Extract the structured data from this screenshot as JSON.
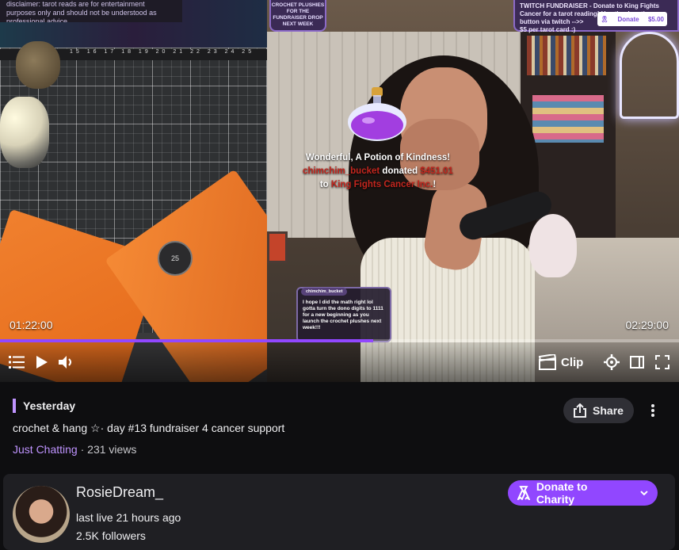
{
  "video": {
    "disclaimer": "disclaimer: tarot reads are for entertainment purposes only and should not be understood as professional advice.",
    "ruler_ticks": "15 16 17 18 19 20 21 22 23 24 25",
    "mat_marker": "25",
    "top_banner": "CROCHET PLUSHIES FOR THE FUNDRAISER DROP NEXT WEEK",
    "top_right_banner_line1": "TWITCH FUNDRAISER - Donate to King Fights",
    "top_right_banner_line2": "Cancer for a tarot reading! Use the donation",
    "top_right_banner_line3": "button via twitch -->>",
    "top_right_banner_line4": "$5 per tarot card :)",
    "dono_pill_label": "Donate",
    "dono_pill_amount": "$5.00",
    "alert": {
      "line1": "Wonderful, A Potion of Kindness!",
      "donor": "chimchim_bucket",
      "donated_word": "donated",
      "amount": "$451.01",
      "to_word": "to",
      "charity": "King Fights Cancer Inc.",
      "exclaim": "!"
    },
    "chat": {
      "username": "chimchim_bucket",
      "message": "I hope I did the math right lol gotta turn the dono digits to 1111 for a new beginning as you launch the crochet plushes next week!!!"
    },
    "time_current": "01:22:00",
    "time_end": "02:29:00",
    "progress": 0.55,
    "clip_label": "Clip"
  },
  "meta": {
    "date_label": "Yesterday",
    "title": "crochet & hang ☆· day #13 fundraiser 4 cancer support",
    "category": "Just Chatting",
    "views": " · 231 views",
    "share_label": "Share"
  },
  "channel": {
    "name": "RosieDream_",
    "last_live": "last live 21 hours ago",
    "followers": "2.5K followers",
    "donate_label": "Donate to Charity"
  },
  "colors": {
    "accent": "#9147ff",
    "accent_light": "#bf94ff",
    "alert_red": "#c2261e"
  }
}
